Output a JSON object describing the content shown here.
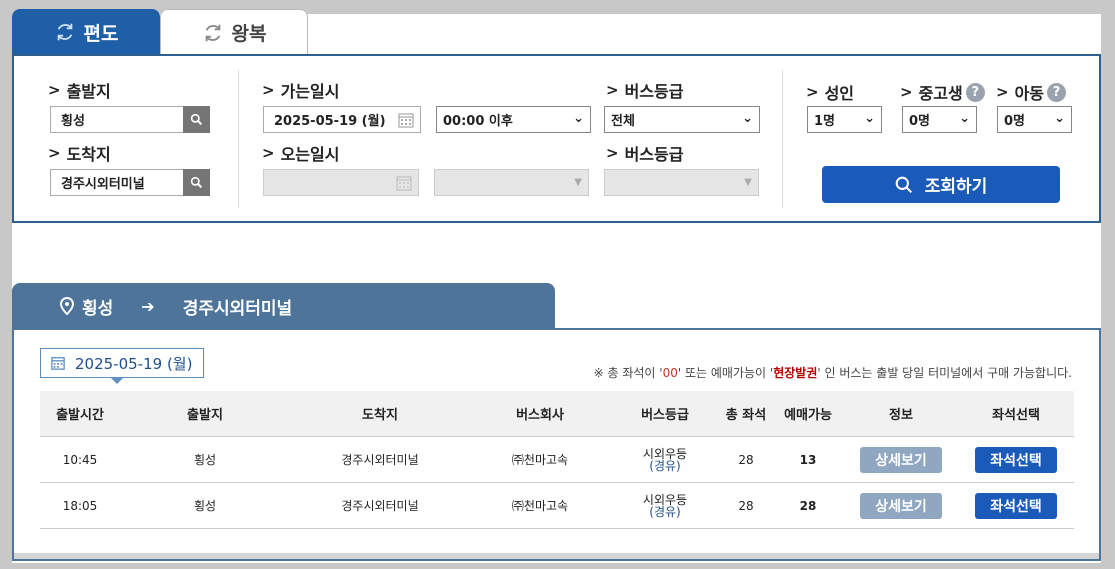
{
  "tabs": [
    {
      "label": "편도",
      "active": true
    },
    {
      "label": "왕복",
      "active": false
    }
  ],
  "search": {
    "departure_label": "출발지",
    "departure_value": "횡성",
    "arrival_label": "도착지",
    "arrival_value": "경주시외터미널",
    "go_date_label": "가는일시",
    "go_date_value": "2025-05-19 (월)",
    "go_time_value": "00:00 이후",
    "return_date_label": "오는일시",
    "grade_label_1": "버스등급",
    "grade_value_1": "전체",
    "grade_label_2": "버스등급",
    "adult_label": "성인",
    "adult_value": "1명",
    "teen_label": "중고생",
    "teen_value": "0명",
    "child_label": "아동",
    "child_value": "0명",
    "help_glyph": "?",
    "submit_label": "조회하기"
  },
  "route": {
    "from": "횡성",
    "to": "경주시외터미널"
  },
  "results": {
    "date": "2025-05-19 (월)",
    "notice_prefix": "※ 총 좌석이 '",
    "notice_zero": "00",
    "notice_mid": "' 또는 예매가능이 '",
    "notice_onsite": "현장발권",
    "notice_suffix": "' 인 버스는 출발 당일 터미널에서 구매 가능합니다.",
    "columns": [
      "출발시간",
      "출발지",
      "도착지",
      "버스회사",
      "버스등급",
      "총 좌석",
      "예매가능",
      "정보",
      "좌석선택"
    ],
    "rows": [
      {
        "time": "10:45",
        "from": "횡성",
        "to": "경주시외터미널",
        "company": "㈜천마고속",
        "grade": "시외우등",
        "grade_sub": "(경유)",
        "total": "28",
        "available": "13",
        "detail": "상세보기",
        "select": "좌석선택"
      },
      {
        "time": "18:05",
        "from": "횡성",
        "to": "경주시외터미널",
        "company": "㈜천마고속",
        "grade": "시외우등",
        "grade_sub": "(경유)",
        "total": "28",
        "available": "28",
        "detail": "상세보기",
        "select": "좌석선택"
      }
    ]
  },
  "colors": {
    "primary": "#1a5ab8",
    "tab_active": "#1f5fa8",
    "route_header": "#4f7499",
    "detail_button": "#8fa7c1",
    "notice_red": "#b30000"
  },
  "icons": [
    "refresh-icon",
    "search-icon",
    "calendar-icon",
    "location-pin-icon",
    "arrow-right-icon",
    "chevron-down-icon",
    "help-icon"
  ]
}
